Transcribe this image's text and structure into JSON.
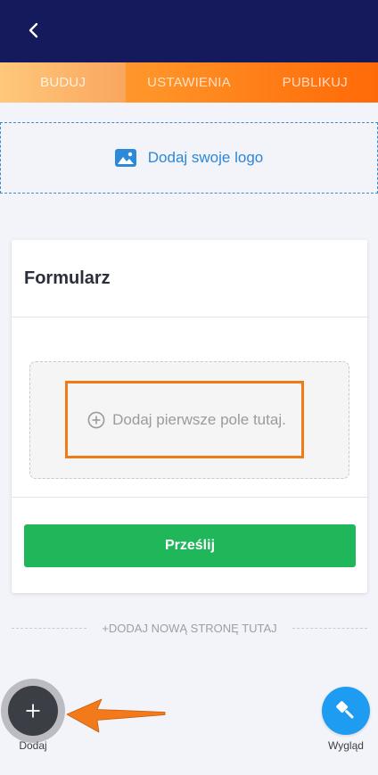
{
  "header": {
    "back_icon": "chevron-left-icon"
  },
  "tabs": [
    {
      "label": "BUDUJ",
      "active": true
    },
    {
      "label": "USTAWIENIA",
      "active": false
    },
    {
      "label": "PUBLIKUJ",
      "active": false
    }
  ],
  "logo_upload": {
    "icon": "image-icon",
    "label": "Dodaj swoje logo"
  },
  "form": {
    "title": "Formularz",
    "empty_field": {
      "icon": "plus-circle-icon",
      "label": "Dodaj pierwsze pole tutaj."
    },
    "submit_label": "Prześlij"
  },
  "add_page": {
    "label": "+DODAJ NOWĄ STRONĘ TUTAJ"
  },
  "bottom_bar": {
    "add": {
      "icon": "plus-icon",
      "label": "Dodaj"
    },
    "appearance": {
      "icon": "paint-brush-icon",
      "label": "Wygląd"
    }
  },
  "annotations": {
    "highlight_target": "empty-field-placeholder",
    "arrow_target": "add-fab"
  },
  "colors": {
    "header_bg": "#141a5b",
    "tab_orange": "#ff8a1e",
    "link_blue": "#2d87d6",
    "submit_green": "#20b65a",
    "fab_dark": "#3b3e45",
    "fab_blue": "#1e9cf1",
    "annotation_orange": "#f07a13"
  }
}
